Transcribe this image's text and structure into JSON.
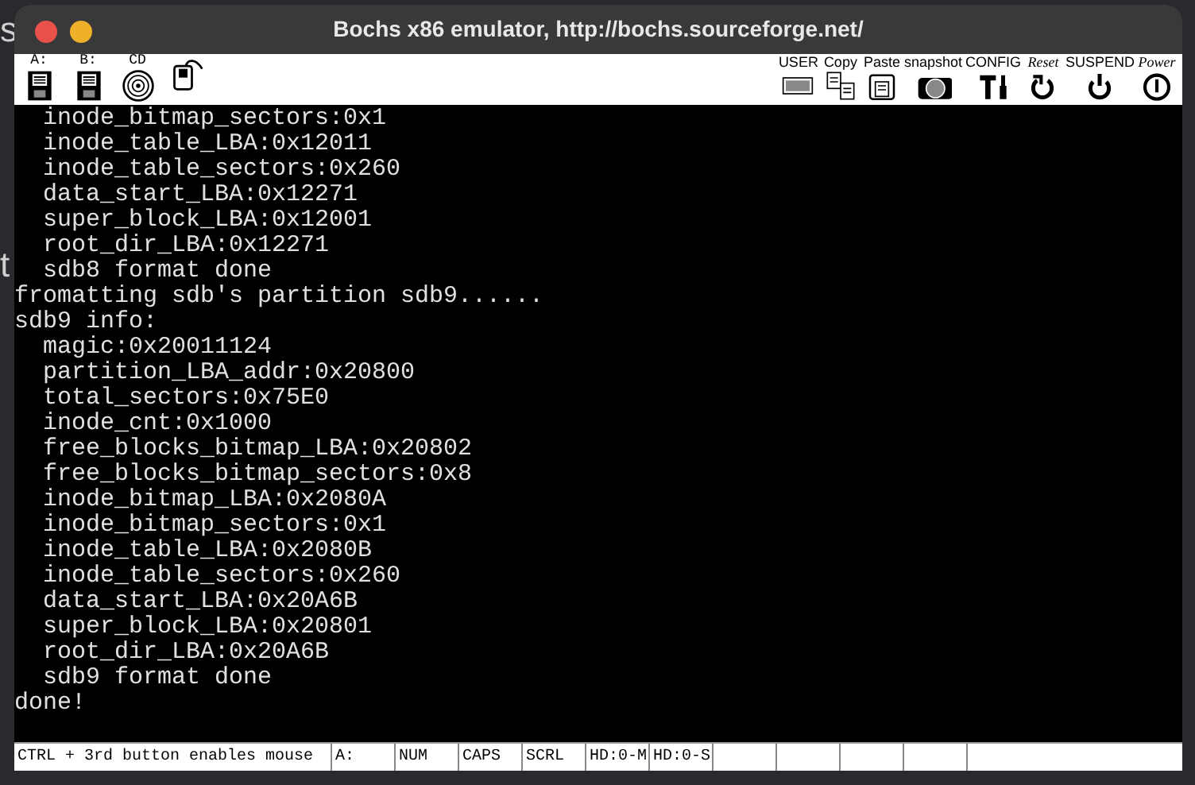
{
  "background_fragments": [
    "s",
    "t"
  ],
  "window": {
    "title": "Bochs x86 emulator, http://bochs.sourceforge.net/"
  },
  "toolbar": {
    "left": [
      {
        "kind": "floppy",
        "label": "A:"
      },
      {
        "kind": "floppy",
        "label": "B:"
      },
      {
        "kind": "cdrom",
        "label": "CD"
      },
      {
        "kind": "mouse"
      }
    ],
    "right": [
      {
        "kind": "user",
        "label": "USER"
      },
      {
        "kind": "copy",
        "label": "Copy"
      },
      {
        "kind": "paste",
        "label": "Paste"
      },
      {
        "kind": "snapshot",
        "label": "snapshot"
      },
      {
        "kind": "config",
        "label": "CONFIG"
      },
      {
        "kind": "reset",
        "label": "Reset"
      },
      {
        "kind": "suspend",
        "label": "SUSPEND"
      },
      {
        "kind": "power",
        "label": "Power"
      }
    ]
  },
  "console_lines": [
    "  inode_bitmap_sectors:0x1",
    "  inode_table_LBA:0x12011",
    "  inode_table_sectors:0x260",
    "  data_start_LBA:0x12271",
    "  super_block_LBA:0x12001",
    "  root_dir_LBA:0x12271",
    "  sdb8 format done",
    "fromatting sdb's partition sdb9......",
    "sdb9 info:",
    "  magic:0x20011124",
    "  partition_LBA_addr:0x20800",
    "  total_sectors:0x75E0",
    "  inode_cnt:0x1000",
    "  free_blocks_bitmap_LBA:0x20802",
    "  free_blocks_bitmap_sectors:0x8",
    "  inode_bitmap_LBA:0x2080A",
    "  inode_bitmap_sectors:0x1",
    "  inode_table_LBA:0x2080B",
    "  inode_table_sectors:0x260",
    "  data_start_LBA:0x20A6B",
    "  super_block_LBA:0x20801",
    "  root_dir_LBA:0x20A6B",
    "  sdb9 format done",
    "done!"
  ],
  "status_bar": [
    "CTRL + 3rd button enables mouse",
    "A:",
    "NUM",
    "CAPS",
    "SCRL",
    "HD:0-M",
    "HD:0-S"
  ]
}
